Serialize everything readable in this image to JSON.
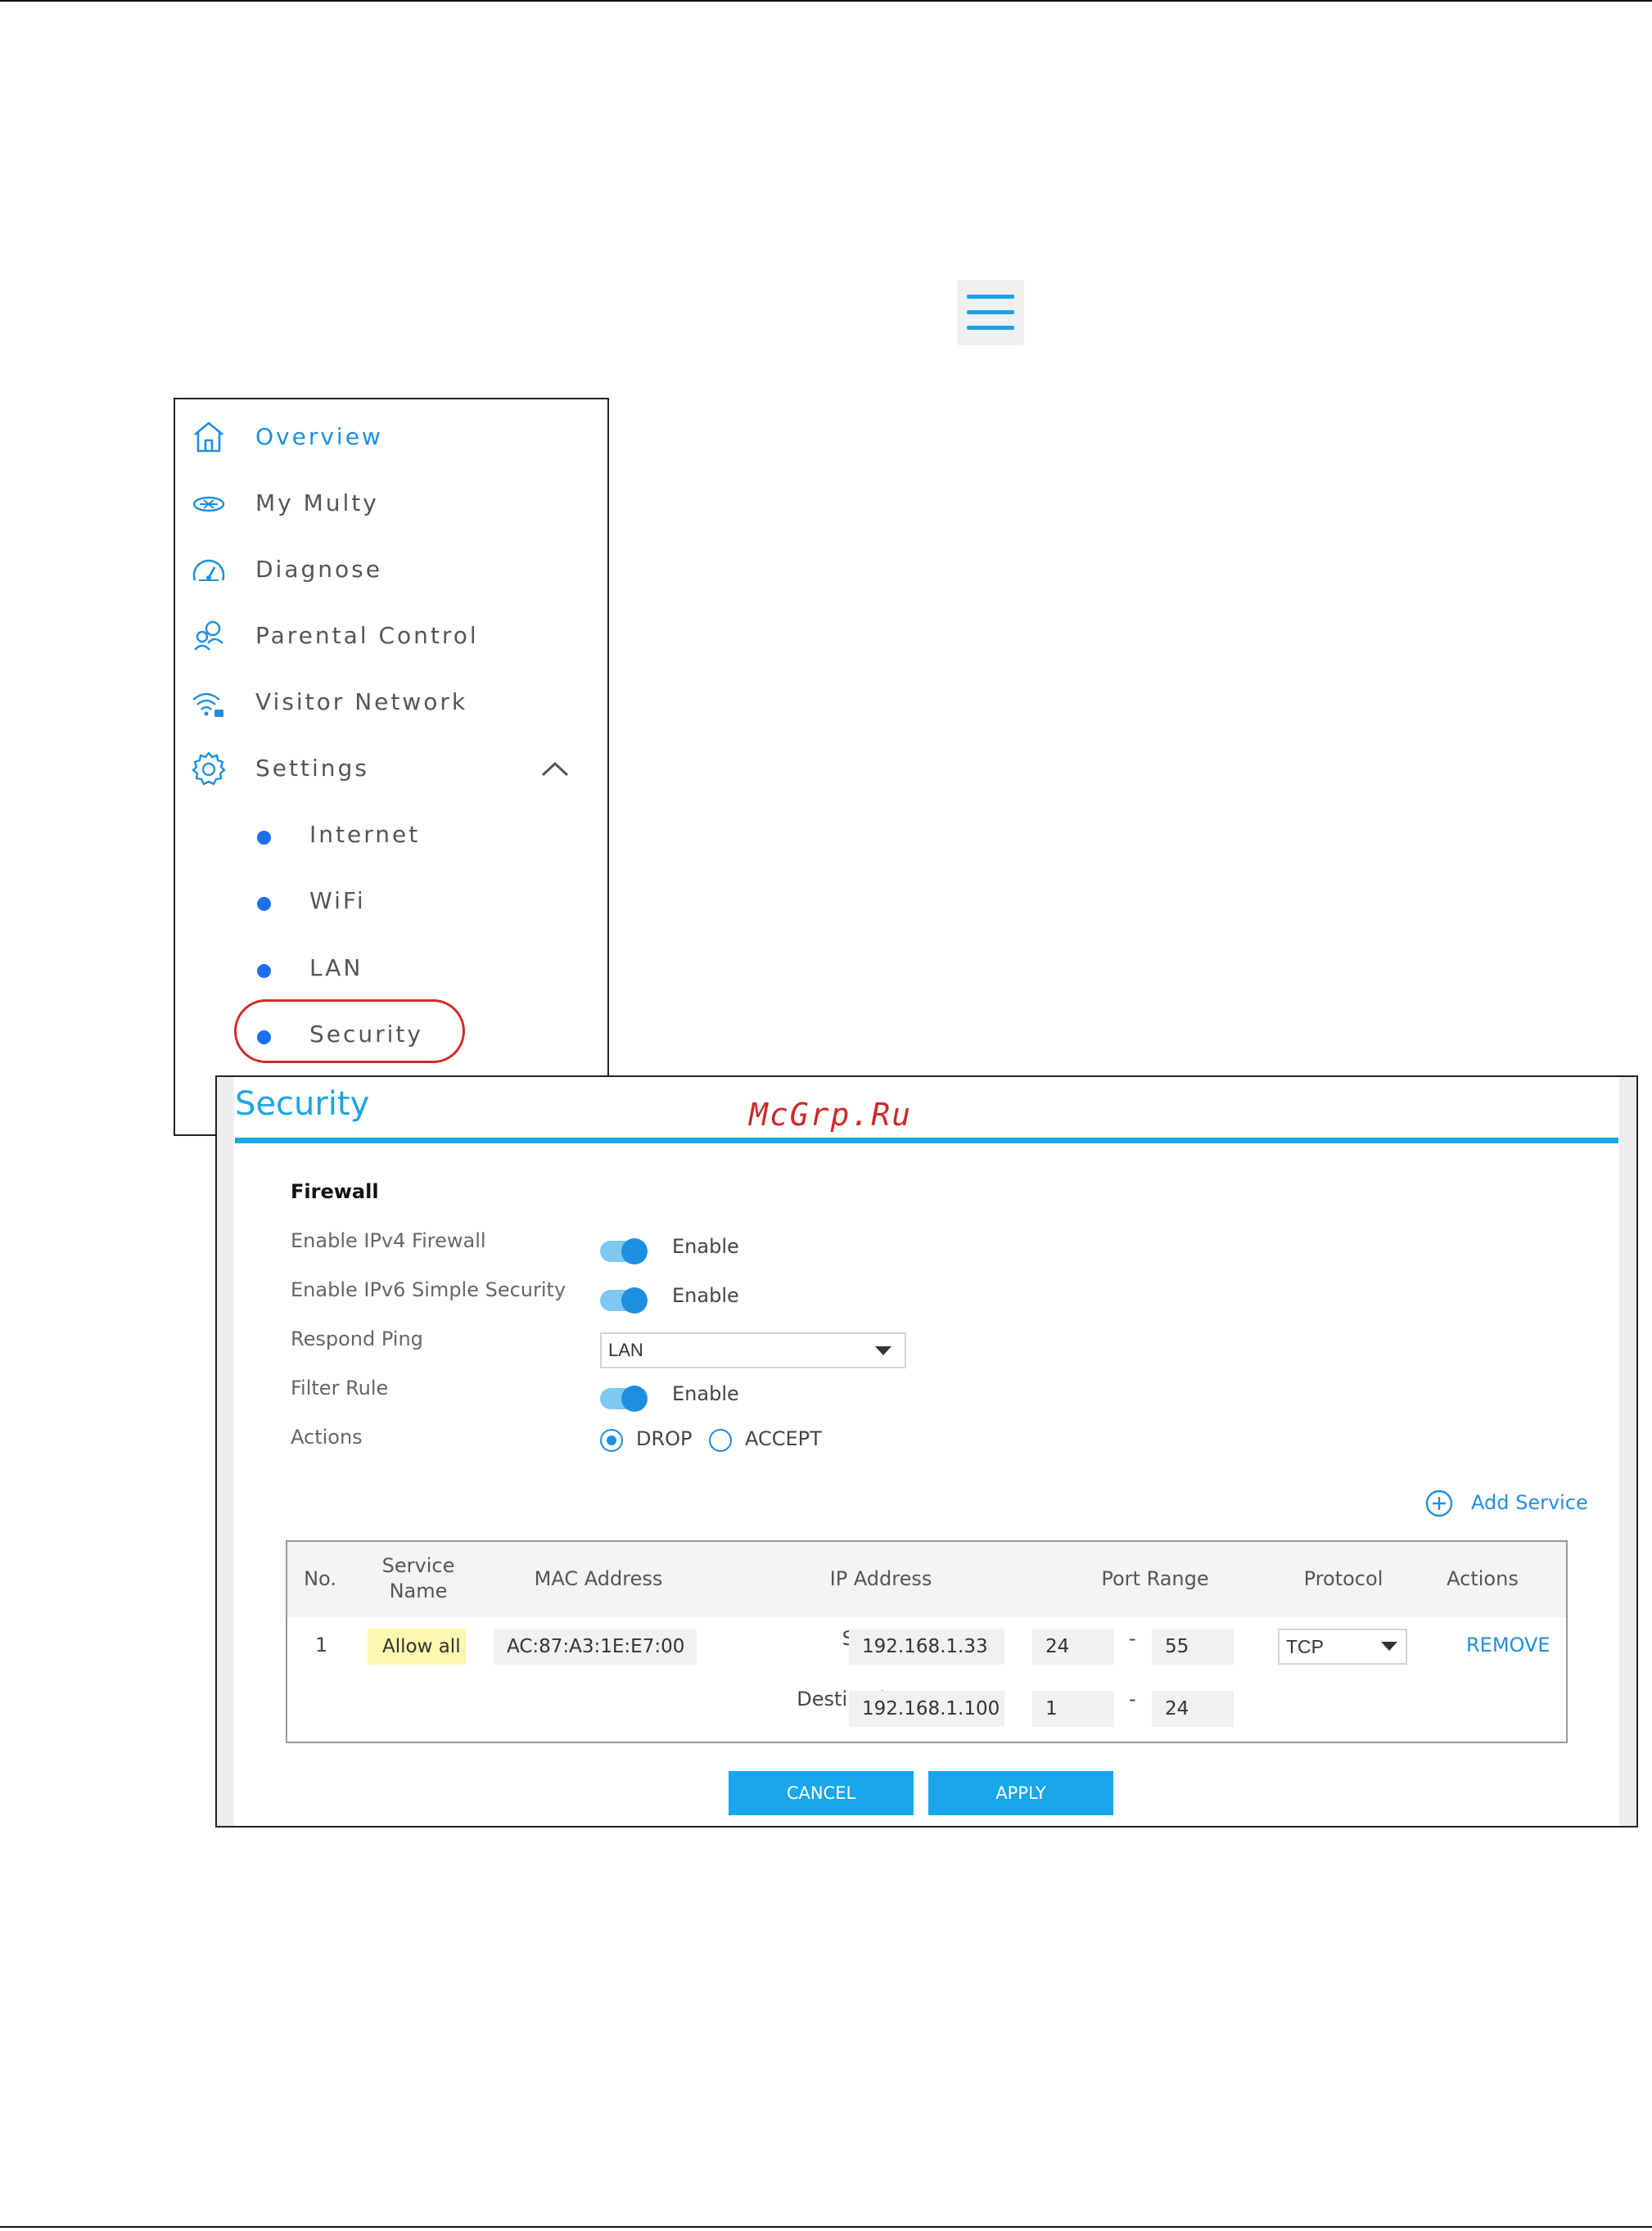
{
  "menu_button": {
    "icon": "hamburger-menu-icon"
  },
  "sidebar": {
    "items": [
      {
        "label": "Overview",
        "icon": "home-icon"
      },
      {
        "label": "My Multy",
        "icon": "multy-device-icon"
      },
      {
        "label": "Diagnose",
        "icon": "speedometer-icon"
      },
      {
        "label": "Parental Control",
        "icon": "parental-control-icon"
      },
      {
        "label": "Visitor Network",
        "icon": "wifi-guest-icon"
      },
      {
        "label": "Settings",
        "icon": "gear-icon"
      }
    ],
    "settings_sub": [
      {
        "label": "Internet"
      },
      {
        "label": "WiFi"
      },
      {
        "label": "LAN"
      },
      {
        "label": "Security"
      }
    ]
  },
  "security": {
    "title": "Security",
    "watermark": "McGrp.Ru",
    "firewall_heading": "Firewall",
    "rows": {
      "ipv4_label": "Enable IPv4 Firewall",
      "ipv4_value": "Enable",
      "ipv6_label": "Enable IPv6 Simple Security",
      "ipv6_value": "Enable",
      "ping_label": "Respond Ping",
      "ping_value": "LAN",
      "filter_label": "Filter Rule",
      "filter_value": "Enable",
      "actions_label": "Actions",
      "action_drop": "DROP",
      "action_accept": "ACCEPT"
    },
    "add_service": "Add Service",
    "table": {
      "headers": [
        "No.",
        "Service\nName",
        "MAC Address",
        "IP Address",
        "Port Range",
        "Protocol",
        "Actions"
      ],
      "row": {
        "no": "1",
        "name": "Allow all",
        "mac": "AC:87:A3:1E:E7:00",
        "source_label": "Source",
        "source_ip": "192.168.1.33",
        "source_port_from": "24",
        "source_port_to": "55",
        "dest_label": "Destination",
        "dest_ip": "192.168.1.100",
        "dest_port_from": "1",
        "dest_port_to": "24",
        "dash": "-",
        "protocol": "TCP",
        "action": "REMOVE"
      }
    },
    "cancel": "CANCEL",
    "apply": "APPLY"
  },
  "colors": {
    "accent": "#1ba5e4",
    "highlight": "#d42828",
    "dot": "#1d6ff0"
  }
}
